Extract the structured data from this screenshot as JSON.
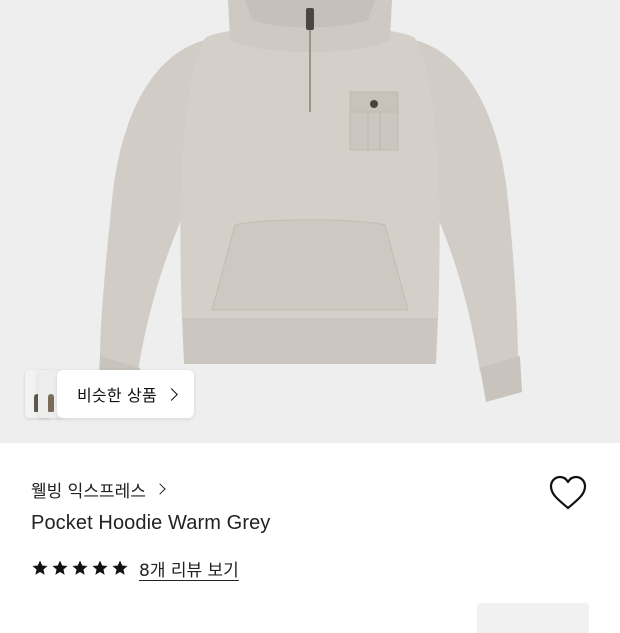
{
  "product_image": {
    "alt": "hoodie-photo",
    "background": "#eeeeee",
    "garment_color": "#d3cdc7"
  },
  "similar_items": {
    "label": "비슷한 상품"
  },
  "brand": {
    "name": "웰빙 익스프레스"
  },
  "product": {
    "name": "Pocket Hoodie Warm Grey"
  },
  "rating": {
    "stars": 5,
    "max_stars": 5,
    "review_link": "8개 리뷰 보기"
  },
  "wishlist": {
    "icon": "heart-icon"
  },
  "colors": {
    "star": "#111111",
    "text": "#222222"
  }
}
